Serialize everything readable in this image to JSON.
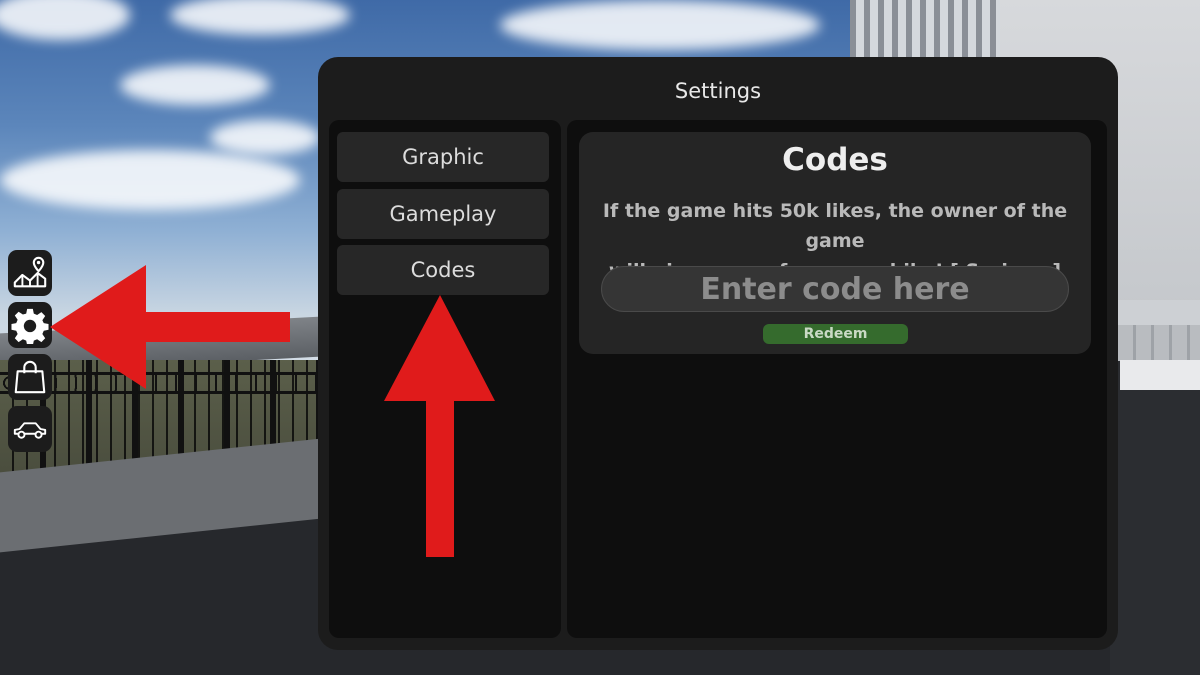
{
  "window": {
    "title": "Settings"
  },
  "tabs": [
    {
      "label": "Graphic"
    },
    {
      "label": "Gameplay"
    },
    {
      "label": "Codes"
    }
  ],
  "codes": {
    "title": "Codes",
    "message_line1": "If the game hits 50k likes, the owner of the game",
    "message_line2": "will giveaway a free superbike!  [ Serious ]",
    "input_placeholder": "Enter code here",
    "input_value": "",
    "redeem_label": "Redeem"
  },
  "hud": {
    "buttons": [
      "map-icon",
      "gear-icon",
      "shopping-bag-icon",
      "car-icon"
    ]
  },
  "colors": {
    "window_bg": "#1c1c1c",
    "panel_bg": "#0e0e0e",
    "tab_bg": "#272727",
    "redeem_green": "#356b2d",
    "arrow_red": "#e01b1b"
  }
}
